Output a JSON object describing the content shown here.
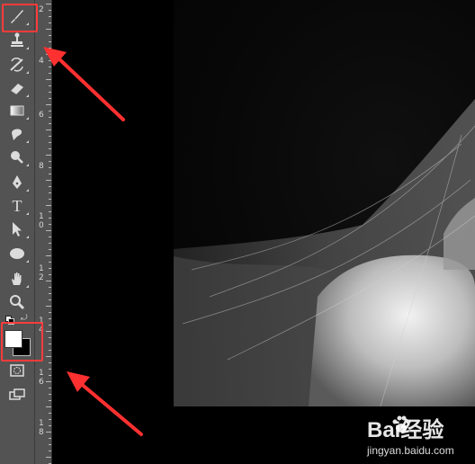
{
  "toolbar": {
    "tools": [
      {
        "name": "brush-icon"
      },
      {
        "name": "clone-stamp-icon"
      },
      {
        "name": "history-brush-icon"
      },
      {
        "name": "eraser-icon"
      },
      {
        "name": "gradient-icon"
      },
      {
        "name": "blur-icon"
      },
      {
        "name": "dodge-icon"
      },
      {
        "name": "pen-icon"
      },
      {
        "name": "type-icon",
        "label": "T"
      },
      {
        "name": "path-selection-icon"
      },
      {
        "name": "ellipse-icon"
      },
      {
        "name": "hand-icon"
      },
      {
        "name": "zoom-icon"
      }
    ],
    "foreground_color": "#ffffff",
    "background_color": "#000000"
  },
  "ruler": {
    "labels": [
      "2",
      "4",
      "6",
      "8",
      "1\n0",
      "1\n2",
      "1\n4",
      "1\n6",
      "1\n8"
    ]
  },
  "watermark": {
    "brand": "Bai经验",
    "url": "jingyan.baidu.com"
  },
  "colors": {
    "highlight": "#ff3b3b",
    "arrow": "#ff3030",
    "panel": "#535353"
  }
}
